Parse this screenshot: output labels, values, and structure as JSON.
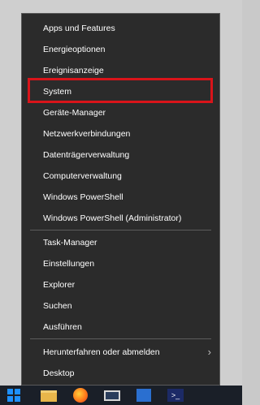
{
  "menu": {
    "items": [
      {
        "label": "Apps und Features"
      },
      {
        "label": "Energieoptionen"
      },
      {
        "label": "Ereignisanzeige"
      },
      {
        "label": "System"
      },
      {
        "label": "Geräte-Manager"
      },
      {
        "label": "Netzwerkverbindungen"
      },
      {
        "label": "Datenträgerverwaltung"
      },
      {
        "label": "Computerverwaltung"
      },
      {
        "label": "Windows PowerShell"
      },
      {
        "label": "Windows PowerShell (Administrator)"
      },
      {
        "label": "Task-Manager"
      },
      {
        "label": "Einstellungen"
      },
      {
        "label": "Explorer"
      },
      {
        "label": "Suchen"
      },
      {
        "label": "Ausführen"
      },
      {
        "label": "Herunterfahren oder abmelden"
      },
      {
        "label": "Desktop"
      }
    ],
    "submenu_arrow": "›",
    "highlighted_item": "System",
    "highlight_color": "#d9141a",
    "background_color": "#2b2b2b"
  },
  "taskbar": {
    "icons": [
      "windows-start-icon",
      "file-explorer-icon",
      "firefox-icon",
      "monitor-icon",
      "blue-app-icon",
      "powershell-icon"
    ],
    "powershell_glyph": ">_"
  }
}
